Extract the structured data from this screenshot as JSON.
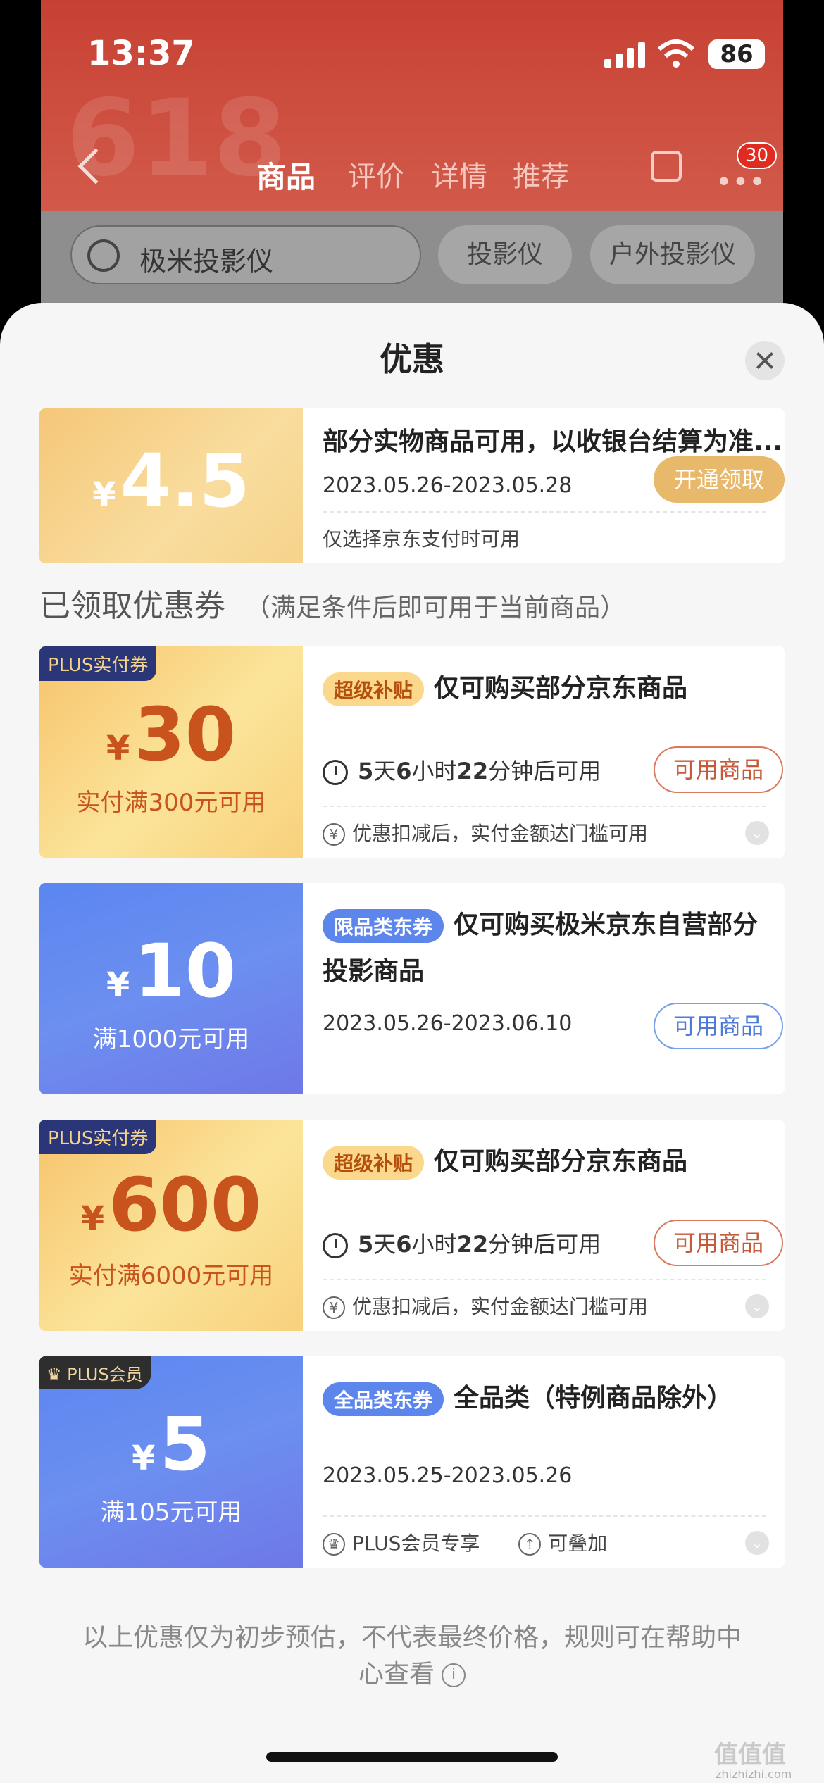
{
  "status": {
    "time": "13:37",
    "battery": "86"
  },
  "nav": {
    "tabs": [
      "商品",
      "评价",
      "详情",
      "推荐"
    ],
    "badge": "30",
    "bg_text": "618"
  },
  "search": {
    "query": "极米投影仪",
    "chips": [
      "投影仪",
      "户外投影仪"
    ]
  },
  "sheet": {
    "title": "优惠"
  },
  "coupon0": {
    "amount": "4.5",
    "yen": "¥",
    "title": "部分实物商品可用，以收银台结算为准...",
    "date": "2023.05.26-2023.05.28",
    "note": "仅选择京东支付时可用",
    "button": "开通领取"
  },
  "section": {
    "heading": "已领取优惠券",
    "sub": "（满足条件后即可用于当前商品）"
  },
  "coupons": [
    {
      "tag": "PLUS实付券",
      "yen": "¥",
      "amount": "30",
      "cond": "实付满300元可用",
      "pill": "超级补贴",
      "title": "仅可购买部分京东商品",
      "time_a": "5",
      "time_b": "天",
      "time_c": "6",
      "time_d": "小时",
      "time_e": "22",
      "time_f": "分钟后可用",
      "note": "优惠扣减后，实付金额达门槛可用",
      "button": "可用商品"
    },
    {
      "yen": "¥",
      "amount": "10",
      "cond": "满1000元可用",
      "pill": "限品类东券",
      "title": "仅可购买极米京东自营部分",
      "title2": "投影商品",
      "date": "2023.05.26-2023.06.10",
      "button": "可用商品"
    },
    {
      "tag": "PLUS实付券",
      "yen": "¥",
      "amount": "600",
      "cond": "实付满6000元可用",
      "pill": "超级补贴",
      "title": "仅可购买部分京东商品",
      "time_a": "5",
      "time_b": "天",
      "time_c": "6",
      "time_d": "小时",
      "time_e": "22",
      "time_f": "分钟后可用",
      "note": "优惠扣减后，实付金额达门槛可用",
      "button": "可用商品"
    },
    {
      "tag": "PLUS会员",
      "yen": "¥",
      "amount": "5",
      "cond": "满105元可用",
      "pill": "全品类东券",
      "title": "全品类（特例商品除外）",
      "date": "2023.05.25-2023.05.26",
      "feature1": "PLUS会员专享",
      "feature2": "可叠加"
    }
  ],
  "footer": {
    "line1": "以上优惠仅为初步预估，不代表最终价格，规则可在帮助中",
    "line2": "心查看"
  },
  "watermark": {
    "text": "值值值",
    "sub": "zhizhizhi.com"
  },
  "colors": {
    "brand_red": "#c74133",
    "gold": "#f5c779",
    "blue": "#5b86f0",
    "accent_text": "#b5500c"
  }
}
